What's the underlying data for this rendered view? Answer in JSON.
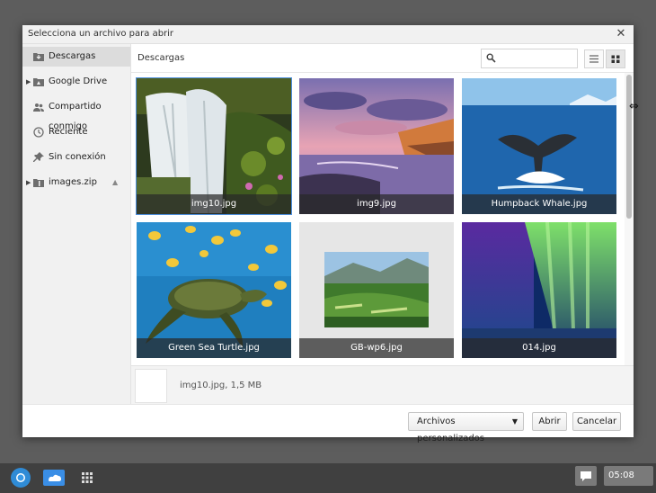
{
  "dialog": {
    "title": "Selecciona un archivo para abrir",
    "close_glyph": "✕"
  },
  "sidebar": {
    "items": [
      {
        "label": "Descargas",
        "icon": "download-folder-icon",
        "active": true
      },
      {
        "label": "Google Drive",
        "icon": "drive-folder-icon",
        "expandable": true
      },
      {
        "label": "Compartido conmigo",
        "icon": "shared-people-icon"
      },
      {
        "label": "Reciente",
        "icon": "clock-icon"
      },
      {
        "label": "Sin conexión",
        "icon": "pin-icon"
      },
      {
        "label": "images.zip",
        "icon": "archive-folder-icon",
        "expandable": true,
        "eject": true
      }
    ]
  },
  "pathbar": {
    "current": "Descargas",
    "search_placeholder": ""
  },
  "files": [
    {
      "name": "img10.jpg",
      "selected": true
    },
    {
      "name": "img9.jpg"
    },
    {
      "name": "Humpback Whale.jpg"
    },
    {
      "name": "Green Sea Turtle.jpg"
    },
    {
      "name": "GB-wp6.jpg"
    },
    {
      "name": "014.jpg"
    }
  ],
  "preview": {
    "info": "img10.jpg, 1,5 MB"
  },
  "footer": {
    "file_type": "Archivos personalizados",
    "open": "Abrir",
    "cancel": "Cancelar"
  },
  "shelf": {
    "time": "05:08"
  },
  "colors": {
    "selection": "#4d8fdf",
    "shelf": "#404040",
    "desktop": "#5d5d5d"
  }
}
